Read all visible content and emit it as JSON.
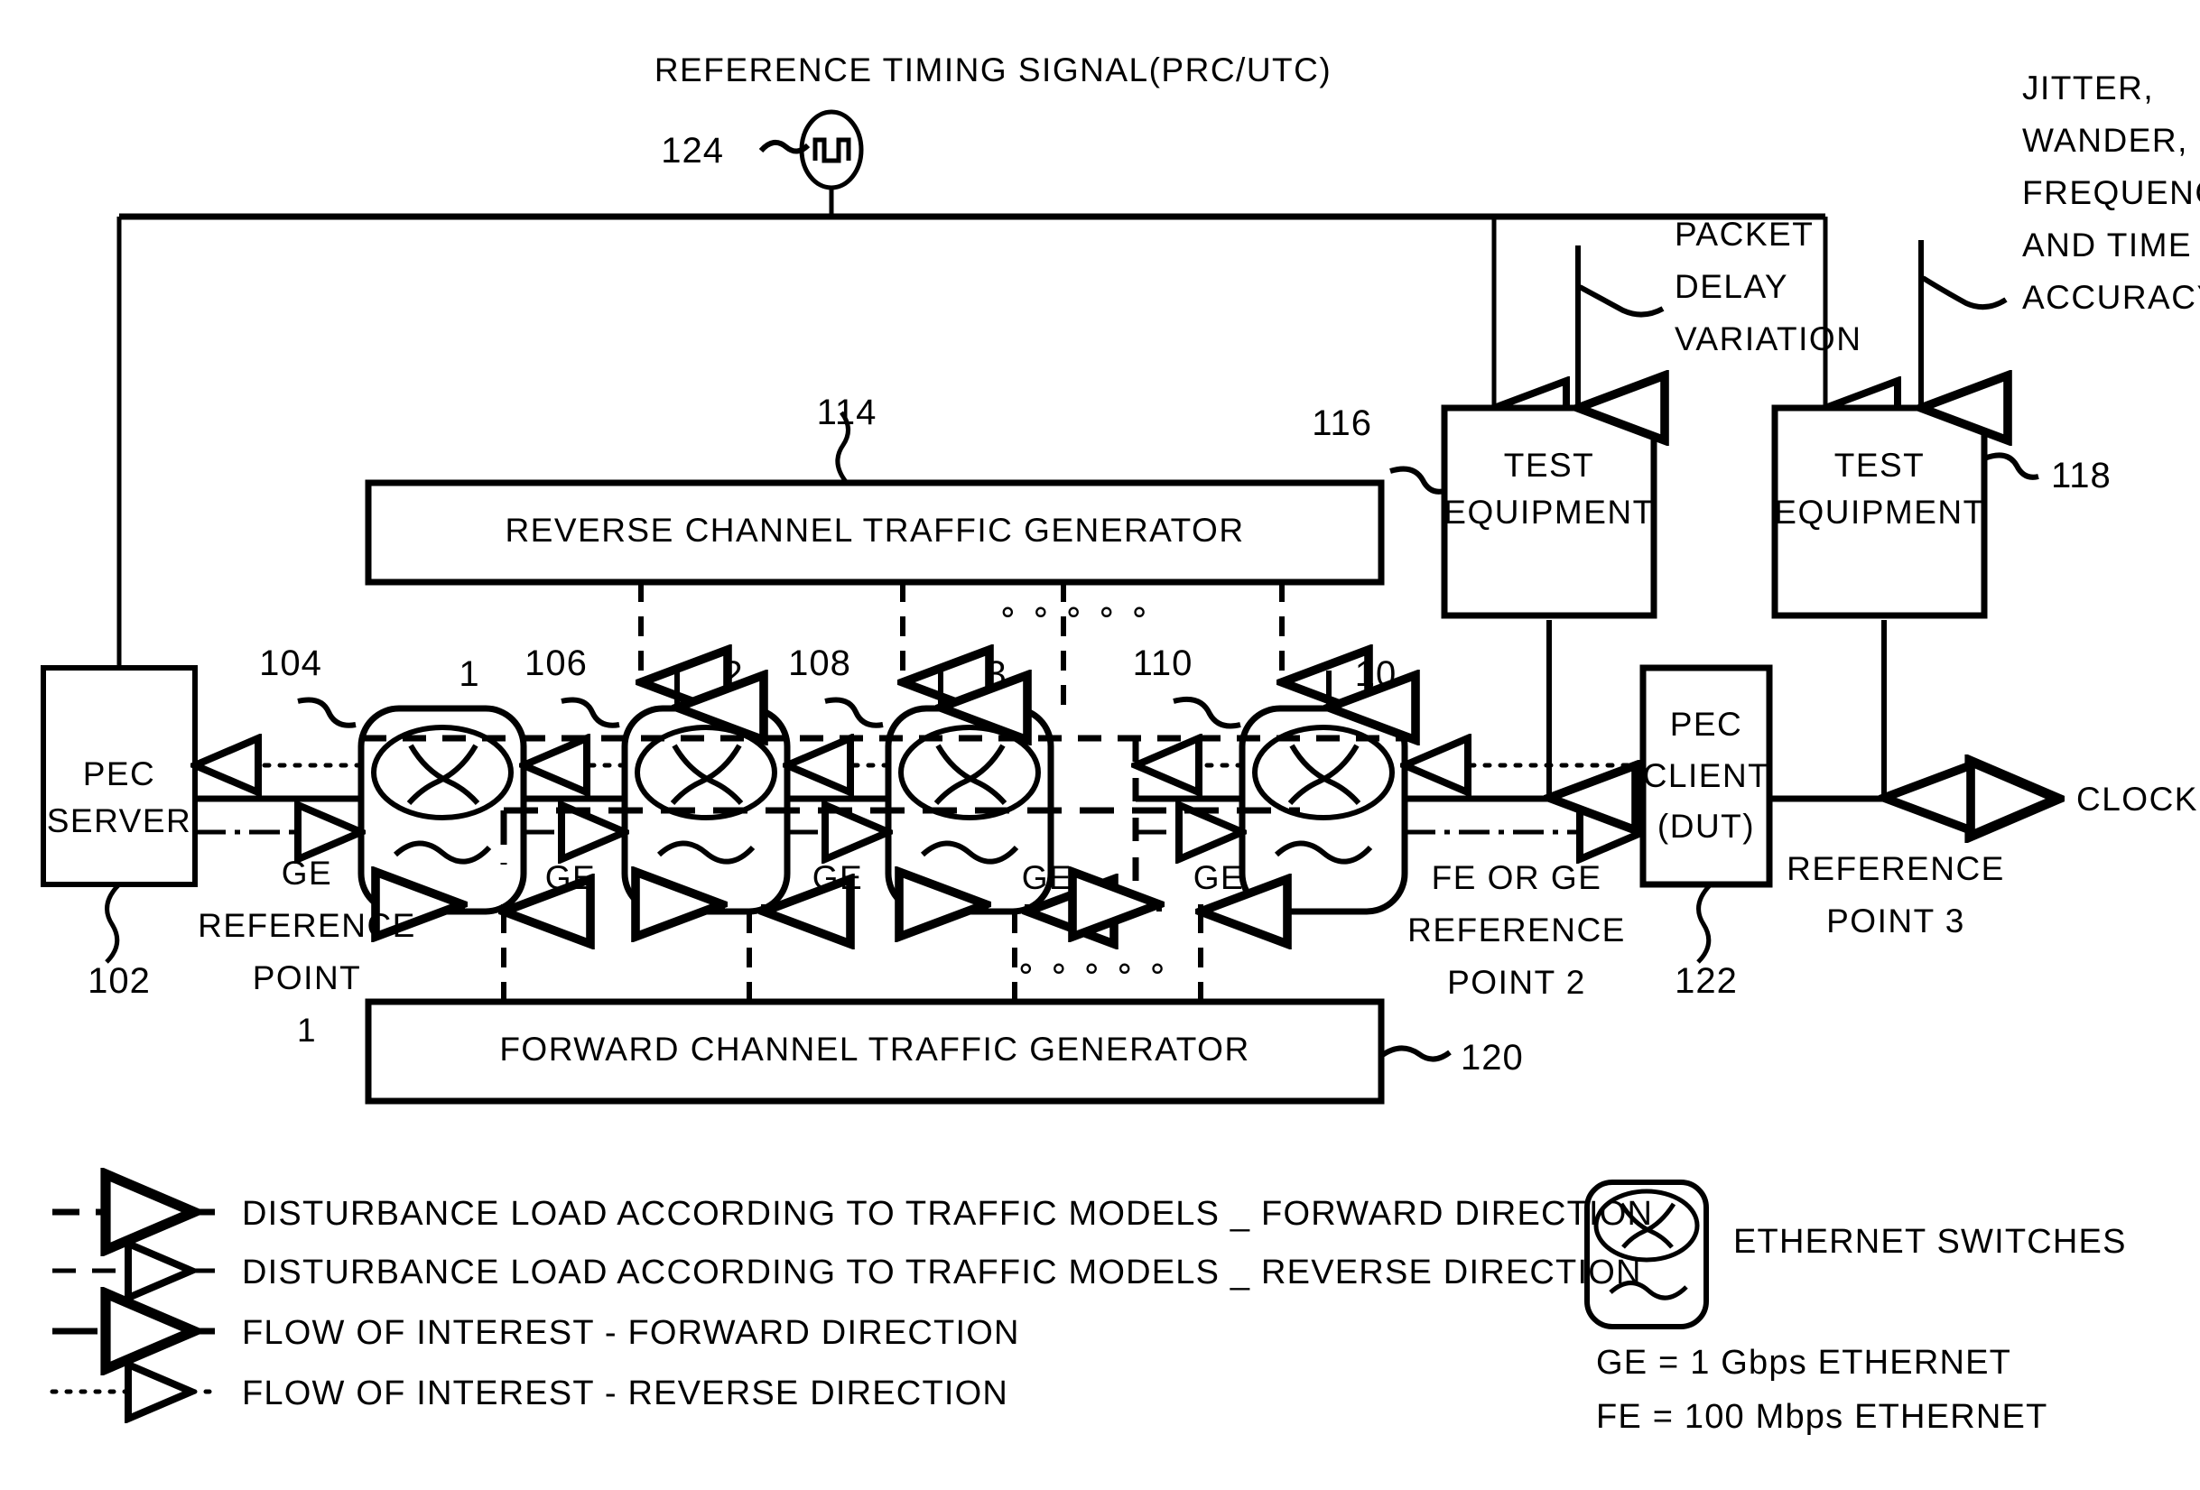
{
  "diagram": {
    "title_top": "REFERENCE TIMING SIGNAL(PRC/UTC)",
    "ref_124": "124",
    "ref_102": "102",
    "ref_104": "104",
    "ref_106": "106",
    "ref_108": "108",
    "ref_110": "110",
    "ref_114": "114",
    "ref_116": "116",
    "ref_118": "118",
    "ref_120": "120",
    "ref_122": "122"
  },
  "blocks": {
    "pec_server_line1": "PEC",
    "pec_server_line2": "SERVER",
    "reverse_generator": "REVERSE CHANNEL TRAFFIC GENERATOR",
    "forward_generator": "FORWARD CHANNEL TRAFFIC GENERATOR",
    "test_equipment_1_line1": "TEST",
    "test_equipment_1_line2": "EQUIPMENT",
    "test_equipment_2_line1": "TEST",
    "test_equipment_2_line2": "EQUIPMENT",
    "pec_client_line1": "PEC",
    "pec_client_line2": "CLIENT",
    "pec_client_line3": "(DUT)"
  },
  "switches": [
    {
      "number": "1",
      "ref": "104"
    },
    {
      "number": "2",
      "ref": "106"
    },
    {
      "number": "3",
      "ref": "108"
    },
    {
      "number": "10",
      "ref": "110"
    }
  ],
  "annotations": {
    "packet_delay_variation": [
      "PACKET",
      "DELAY",
      "VARIATION"
    ],
    "jitter_wander": [
      "JITTER,",
      "WANDER,",
      "FREQUENCY",
      "AND TIME",
      "ACCURACY"
    ],
    "ge_reference_point_1": [
      "GE",
      "REFERENCE",
      "POINT",
      "1"
    ],
    "fe_or_ge_reference_point_2": [
      "FE OR GE",
      "REFERENCE",
      "POINT 2"
    ],
    "reference_point_3": [
      "REFERENCE",
      "POINT 3"
    ],
    "clock": "CLOCK",
    "ge_links": [
      "GE",
      "GE",
      "GE",
      "GE"
    ],
    "ellipsis": "∘ ∘ ∘ ∘ ∘"
  },
  "legend": {
    "items": [
      {
        "style": "dashed-long",
        "label": "DISTURBANCE LOAD ACCORDING TO TRAFFIC MODELS _ FORWARD DIRECTION"
      },
      {
        "style": "dashed-short",
        "label": "DISTURBANCE LOAD ACCORDING TO TRAFFIC MODELS _ REVERSE DIRECTION"
      },
      {
        "style": "dash-dot",
        "label": "FLOW OF INTEREST - FORWARD DIRECTION"
      },
      {
        "style": "dotted",
        "label": "FLOW OF INTEREST - REVERSE DIRECTION"
      }
    ],
    "switch_symbol_label": "ETHERNET SWITCHES",
    "ge_definition": "GE = 1 Gbps ETHERNET",
    "fe_definition": "FE = 100 Mbps ETHERNET"
  },
  "colors": {
    "stroke": "#000000",
    "background": "#ffffff"
  }
}
